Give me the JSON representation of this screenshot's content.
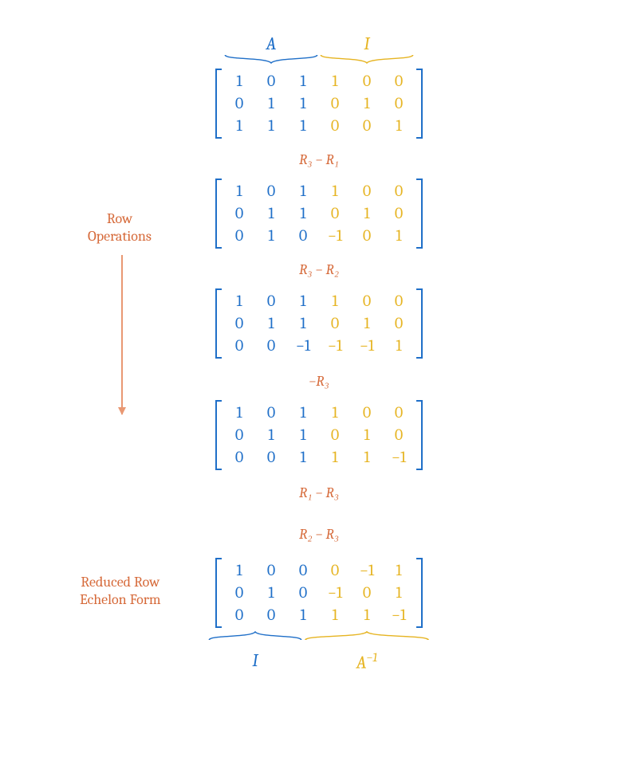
{
  "colors": {
    "blue": "#1f6fc8",
    "gold": "#e6b422",
    "orange": "#d66a3a"
  },
  "labels": {
    "top_left": "A",
    "top_right": "I",
    "bottom_left": "I",
    "bottom_right_base": "A",
    "bottom_right_exp": "−1",
    "side_row_ops_l1": "Row",
    "side_row_ops_l2": "Operations",
    "rref_l1": "Reduced Row",
    "rref_l2": "Echelon Form"
  },
  "ops": {
    "op1": "R₃ − R₁",
    "op2": "R₃ − R₂",
    "op3": "−R₃",
    "op4": "R₁ − R₃",
    "op5": "R₂ − R₃"
  },
  "chart_data": {
    "type": "table",
    "title": "Gauss-Jordan elimination to find A inverse via augmented matrix [A | I]",
    "steps": [
      {
        "op": null,
        "left": [
          [
            1,
            0,
            1
          ],
          [
            0,
            1,
            1
          ],
          [
            1,
            1,
            1
          ]
        ],
        "right": [
          [
            1,
            0,
            0
          ],
          [
            0,
            1,
            0
          ],
          [
            0,
            0,
            1
          ]
        ]
      },
      {
        "op": "R3 - R1",
        "left": [
          [
            1,
            0,
            1
          ],
          [
            0,
            1,
            1
          ],
          [
            0,
            1,
            0
          ]
        ],
        "right": [
          [
            1,
            0,
            0
          ],
          [
            0,
            1,
            0
          ],
          [
            -1,
            0,
            1
          ]
        ]
      },
      {
        "op": "R3 - R2",
        "left": [
          [
            1,
            0,
            1
          ],
          [
            0,
            1,
            1
          ],
          [
            0,
            0,
            -1
          ]
        ],
        "right": [
          [
            1,
            0,
            0
          ],
          [
            0,
            1,
            0
          ],
          [
            -1,
            -1,
            1
          ]
        ]
      },
      {
        "op": "-R3",
        "left": [
          [
            1,
            0,
            1
          ],
          [
            0,
            1,
            1
          ],
          [
            0,
            0,
            1
          ]
        ],
        "right": [
          [
            1,
            0,
            0
          ],
          [
            0,
            1,
            0
          ],
          [
            1,
            1,
            -1
          ]
        ]
      },
      {
        "op": "R1 - R3; R2 - R3",
        "left": [
          [
            1,
            0,
            0
          ],
          [
            0,
            1,
            0
          ],
          [
            0,
            0,
            1
          ]
        ],
        "right": [
          [
            0,
            -1,
            1
          ],
          [
            -1,
            0,
            1
          ],
          [
            1,
            1,
            -1
          ]
        ]
      }
    ],
    "result_A_inverse": [
      [
        0,
        -1,
        1
      ],
      [
        -1,
        0,
        1
      ],
      [
        1,
        1,
        -1
      ]
    ]
  }
}
